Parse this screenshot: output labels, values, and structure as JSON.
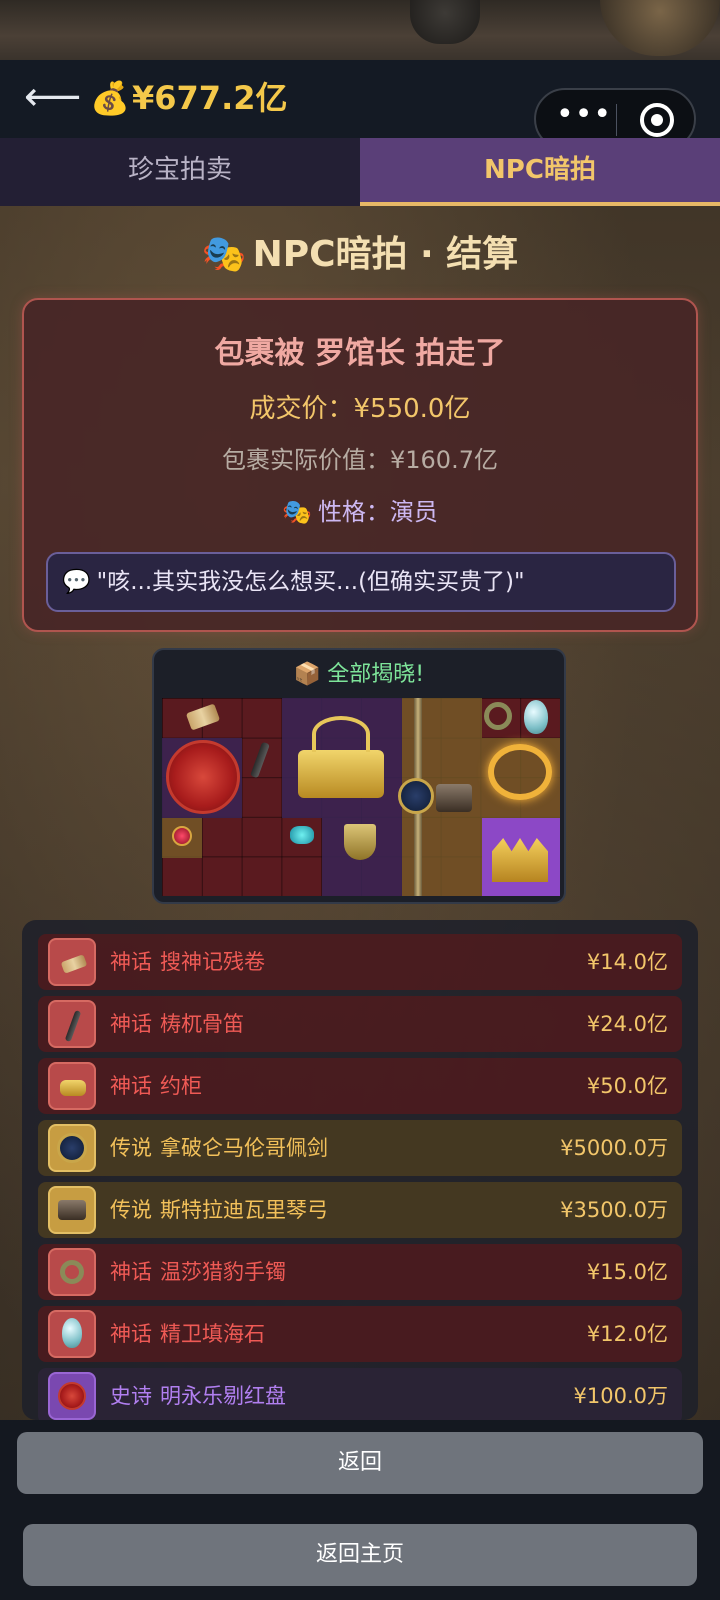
{
  "header": {
    "balance": "¥677.2亿",
    "back_icon": "arrow-left-icon",
    "money_icon": "money-bag-icon"
  },
  "capsule": {
    "more_icon": "more-dots-icon",
    "close_icon": "target-circle-icon"
  },
  "tabs": [
    {
      "label": "珍宝拍卖",
      "active": false
    },
    {
      "label": "NPC暗拍",
      "active": true
    }
  ],
  "section": {
    "title": "NPC暗拍 · 结算",
    "icon": "theater-masks-icon"
  },
  "result": {
    "winner": "包裹被 罗馆长 拍走了",
    "deal_price": "成交价：¥550.0亿",
    "actual_value": "包裹实际价值：¥160.7亿",
    "personality": "性格：演员",
    "personality_icon": "theater-masks-icon",
    "quote": "\"咳...其实我没怎么想买...(但确实买贵了)\"",
    "quote_icon": "speech-bubble-icon"
  },
  "reveal": {
    "title": "全部揭晓!",
    "icon": "package-icon"
  },
  "items": [
    {
      "rarity": "神话",
      "name": "搜神记残卷",
      "price": "¥14.0亿",
      "tier": "myth",
      "icon": "scroll-icon"
    },
    {
      "rarity": "神话",
      "name": "梼杌骨笛",
      "price": "¥24.0亿",
      "tier": "myth",
      "icon": "bone-flute-icon"
    },
    {
      "rarity": "神话",
      "name": "约柜",
      "price": "¥50.0亿",
      "tier": "myth",
      "icon": "ark-icon"
    },
    {
      "rarity": "传说",
      "name": "拿破仑马伦哥佩剑",
      "price": "¥5000.0万",
      "tier": "legend",
      "icon": "sword-icon"
    },
    {
      "rarity": "传说",
      "name": "斯特拉迪瓦里琴弓",
      "price": "¥3500.0万",
      "tier": "legend",
      "icon": "violin-bow-icon"
    },
    {
      "rarity": "神话",
      "name": "温莎猎豹手镯",
      "price": "¥15.0亿",
      "tier": "myth",
      "icon": "bracelet-icon"
    },
    {
      "rarity": "神话",
      "name": "精卫填海石",
      "price": "¥12.0亿",
      "tier": "myth",
      "icon": "stone-egg-icon"
    },
    {
      "rarity": "史诗",
      "name": "明永乐剔红盘",
      "price": "¥100.0万",
      "tier": "epic",
      "icon": "red-plate-icon"
    }
  ],
  "buttons": {
    "return": "返回",
    "home": "返回主页"
  }
}
